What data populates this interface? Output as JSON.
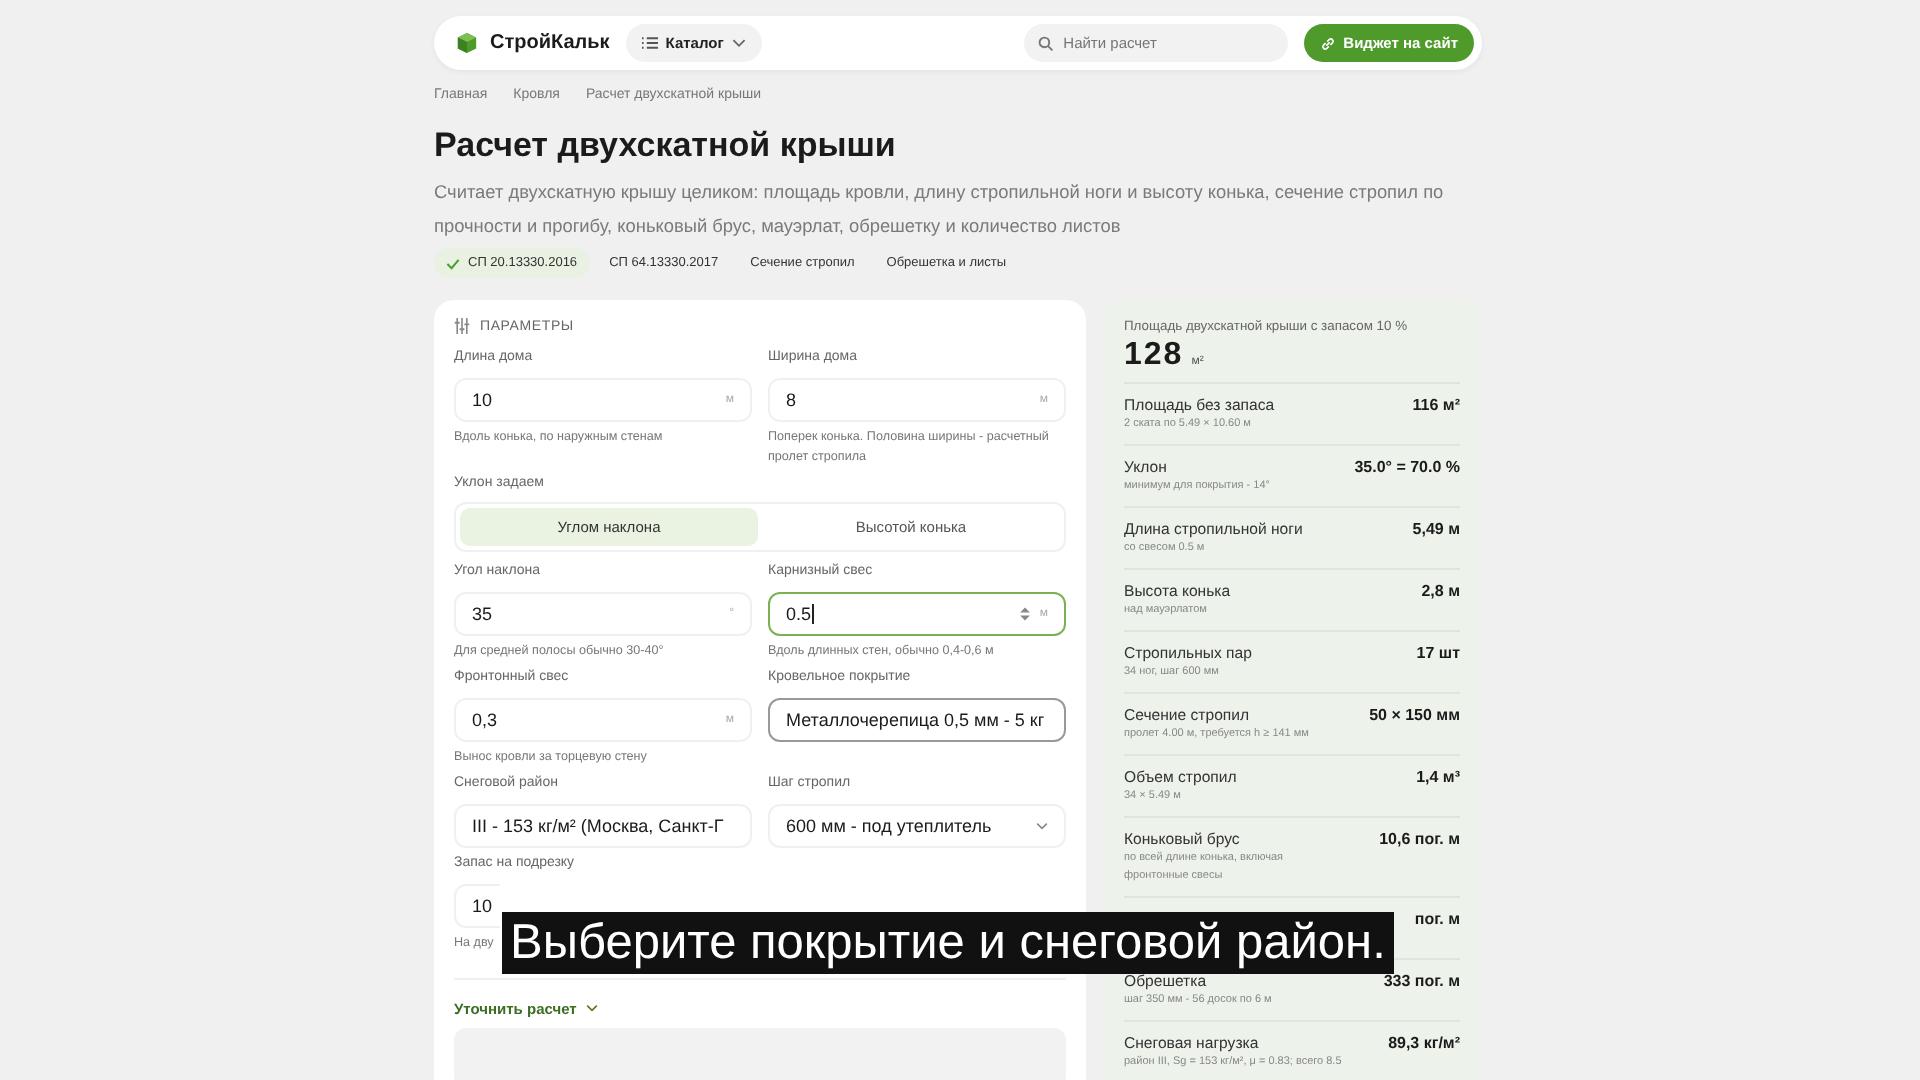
{
  "header": {
    "logo": "СтройКальк",
    "catalog": "Каталог",
    "search": {
      "placeholder": "Найти расчет"
    },
    "widget_button": "Виджет на сайт"
  },
  "breadcrumbs": [
    "Главная",
    "Кровля",
    "Расчет двухскатной крыши"
  ],
  "title": "Расчет двухскатной крыши",
  "description": "Считает двухскатную крышу целиком: площадь кровли, длину стропильной ноги и высоту конька, сечение стропил по прочности и прогибу, коньковый брус, мауэрлат, обрешетку и количество листов",
  "tags": [
    {
      "label": "СП 20.13330.2016",
      "checked": true
    },
    {
      "label": "СП 64.13330.2017",
      "checked": false
    },
    {
      "label": "Сечение стропил",
      "checked": false
    },
    {
      "label": "Обрешетка и листы",
      "checked": false
    }
  ],
  "params": {
    "heading": "ПАРАМЕТРЫ",
    "rows": [
      {
        "kind": "fields",
        "fields": [
          {
            "kind": "input",
            "label": "Длина дома",
            "value": "10",
            "unit": "м",
            "hint": "Вдоль конька, по наружным стенам",
            "focused": false
          },
          {
            "kind": "input",
            "label": "Ширина дома",
            "value": "8",
            "unit": "м",
            "hint": "Поперек конька. Половина ширины - расчетный пролет стропила",
            "focused": false
          }
        ]
      },
      {
        "kind": "toggle",
        "label": "Уклон задаем",
        "options": [
          {
            "label": "Углом наклона",
            "selected": true
          },
          {
            "label": "Высотой конька",
            "selected": false
          }
        ]
      },
      {
        "kind": "fields",
        "fields": [
          {
            "kind": "input",
            "label": "Угол наклона",
            "value": "35",
            "unit": "°",
            "hint": "Для средней полосы обычно 30-40°",
            "focused": false
          },
          {
            "kind": "input",
            "label": "Карнизный свес",
            "value": "0.5",
            "unit": "м",
            "hint": "Вдоль длинных стен, обычно 0,4-0,6 м",
            "focused": true
          }
        ]
      },
      {
        "kind": "fields",
        "fields": [
          {
            "kind": "input",
            "label": "Фронтонный свес",
            "value": "0,3",
            "unit": "м",
            "hint": "Вынос кровли за торцевую стену",
            "focused": false
          },
          {
            "kind": "select",
            "label": "Кровельное покрытие",
            "value": "Металлочерепица 0,5 мм - 5 кг",
            "focused": true
          }
        ]
      },
      {
        "kind": "fields",
        "fields": [
          {
            "kind": "select",
            "label": "Снеговой район",
            "value": "III - 153 кг/м² (Москва, Санкт-Г",
            "focused": false
          },
          {
            "kind": "select",
            "label": "Шаг стропил",
            "value": "600 мм - под утеплитель",
            "focused": false
          }
        ]
      },
      {
        "kind": "fields",
        "fields": [
          {
            "kind": "input",
            "label": "Запас на подрезку",
            "value": "10",
            "hint": "На дву",
            "focused": false
          }
        ]
      }
    ],
    "refine_link": "Уточнить расчет"
  },
  "results": {
    "total_label": "Площадь двухскатной крыши с запасом 10 %",
    "total_value": "128",
    "total_unit": "м²",
    "rows": [
      {
        "label": "Площадь без запаса",
        "note": "2 ската по 5.49 × 10.60 м",
        "value": "116 м²"
      },
      {
        "label": "Уклон",
        "note": "минимум для покрытия - 14°",
        "value": "35.0° = 70.0 %"
      },
      {
        "label": "Длина стропильной ноги",
        "note": "со свесом 0.5 м",
        "value": "5,49 м"
      },
      {
        "label": "Высота конька",
        "note": "над мауэрлатом",
        "value": "2,8 м"
      },
      {
        "label": "Стропильных пар",
        "note": "34 ног, шаг 600 мм",
        "value": "17 шт"
      },
      {
        "label": "Сечение стропил",
        "note": "пролет 4.00 м, требуется h ≥ 141 мм",
        "value": "50 × 150 мм"
      },
      {
        "label": "Объем стропил",
        "note": "34 × 5.49 м",
        "value": "1,4 м³"
      },
      {
        "label": "Коньковый брус",
        "note": "по всей длине конька, включая фронтонные свесы",
        "value": "10,6 пог. м"
      },
      {
        "value": "пог. м"
      },
      {
        "label": "Обрешетка",
        "note": "шаг 350 мм - 56 досок по 6 м",
        "value": "333 пог. м"
      },
      {
        "label": "Снеговая нагрузка",
        "note": "район III, Sg = 153 кг/м², μ = 0.83; всего 8.5",
        "value": "89,3 кг/м²"
      }
    ]
  },
  "subtitle": "Выберите покрытие и снеговой район."
}
